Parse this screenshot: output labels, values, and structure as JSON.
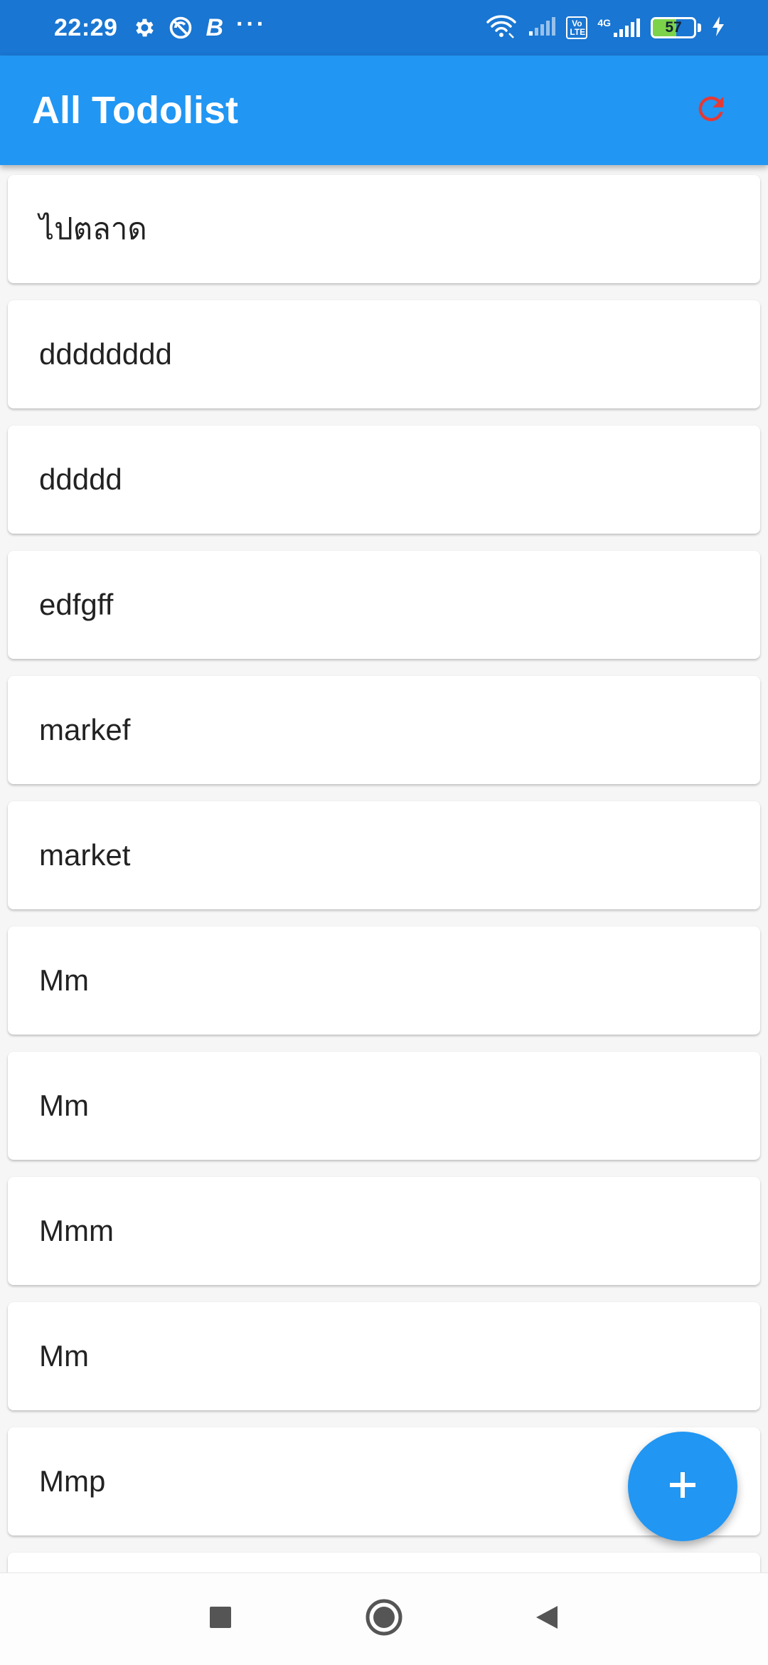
{
  "status_bar": {
    "time": "22:29",
    "left_icons": [
      "gear-icon",
      "do-not-disturb-icon",
      "b-icon",
      "more-icon"
    ],
    "b_label": "B",
    "more_label": "···",
    "volte_label": "Vo LTE",
    "network_label": "4G",
    "battery_level": "57",
    "battery_percent": 57,
    "charging": true
  },
  "app_bar": {
    "title": "All Todolist",
    "refresh_icon": "refresh-icon",
    "refresh_color": "#e53935"
  },
  "colors": {
    "primary": "#2196f3",
    "status_bar": "#1976d2",
    "background": "#f6f6f6"
  },
  "todos": [
    {
      "label": "ไปตลาด"
    },
    {
      "label": "dddddddd"
    },
    {
      "label": "ddddd"
    },
    {
      "label": "edfgff"
    },
    {
      "label": "markef"
    },
    {
      "label": "market"
    },
    {
      "label": "Mm"
    },
    {
      "label": "Mm"
    },
    {
      "label": "Mmm"
    },
    {
      "label": "Mm"
    },
    {
      "label": "Mmp"
    },
    {
      "label": ""
    }
  ],
  "fab": {
    "icon": "plus-icon"
  },
  "nav_bar": {
    "buttons": [
      "recents-icon",
      "home-icon",
      "back-icon"
    ]
  }
}
